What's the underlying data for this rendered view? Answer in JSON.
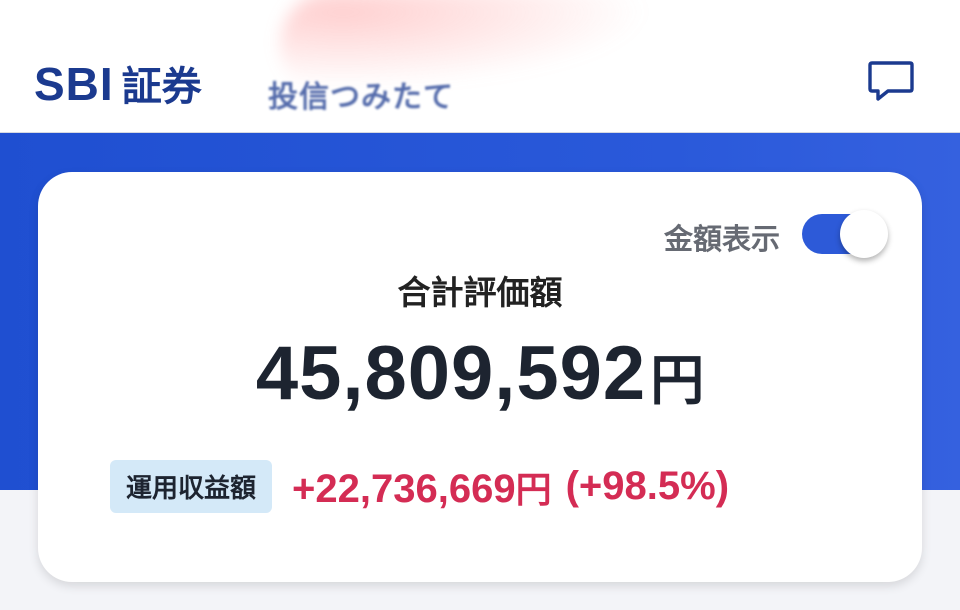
{
  "header": {
    "brand": "SBI",
    "brand_jp": "証券",
    "service_title": "投信つみたて",
    "chat_icon": "chat-bubble-icon"
  },
  "card": {
    "toggle_label": "金額表示",
    "toggle_state": "on",
    "title": "合計評価額",
    "total_amount": "45,809,592",
    "total_unit": "円",
    "profit_label": "運用収益額",
    "profit_amount": "+22,736,669",
    "profit_unit": "円",
    "profit_percent": "(+98.5%)"
  },
  "colors": {
    "brand": "#1b3a8f",
    "band": "#2a59da",
    "profit": "#d42c54",
    "badge": "#d4e9f8"
  }
}
